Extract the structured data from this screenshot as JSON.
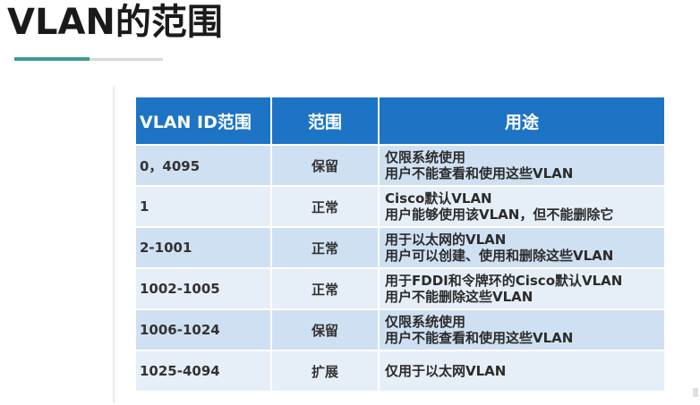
{
  "slide": {
    "title": "VLAN的范围"
  },
  "table": {
    "headers": [
      "VLAN ID范围",
      "范围",
      "用途"
    ],
    "rows": [
      {
        "range": "0，4095",
        "scope": "保留",
        "usage": [
          "仅限系统使用",
          "用户不能查看和使用这些VLAN"
        ]
      },
      {
        "range": "1",
        "scope": "正常",
        "usage": [
          "Cisco默认VLAN",
          "用户能够使用该VLAN，但不能删除它"
        ]
      },
      {
        "range": "2-1001",
        "scope": "正常",
        "usage": [
          "用于以太网的VLAN",
          "用户可以创建、使用和删除这些VLAN"
        ]
      },
      {
        "range": "1002-1005",
        "scope": "正常",
        "usage": [
          "用于FDDI和令牌环的Cisco默认VLAN",
          "用户不能删除这些VLAN"
        ]
      },
      {
        "range": "1006-1024",
        "scope": "保留",
        "usage": [
          "仅限系统使用",
          "用户不能查看和使用这些VLAN"
        ]
      },
      {
        "range": "1025-4094",
        "scope": "扩展",
        "usage": [
          "仅用于以太网VLAN"
        ]
      }
    ]
  },
  "colors": {
    "header_bg": "#1d74c4",
    "row_dark": "#cfe0f2",
    "row_light": "#e6eef8",
    "accent_line": "#3f9a95"
  }
}
